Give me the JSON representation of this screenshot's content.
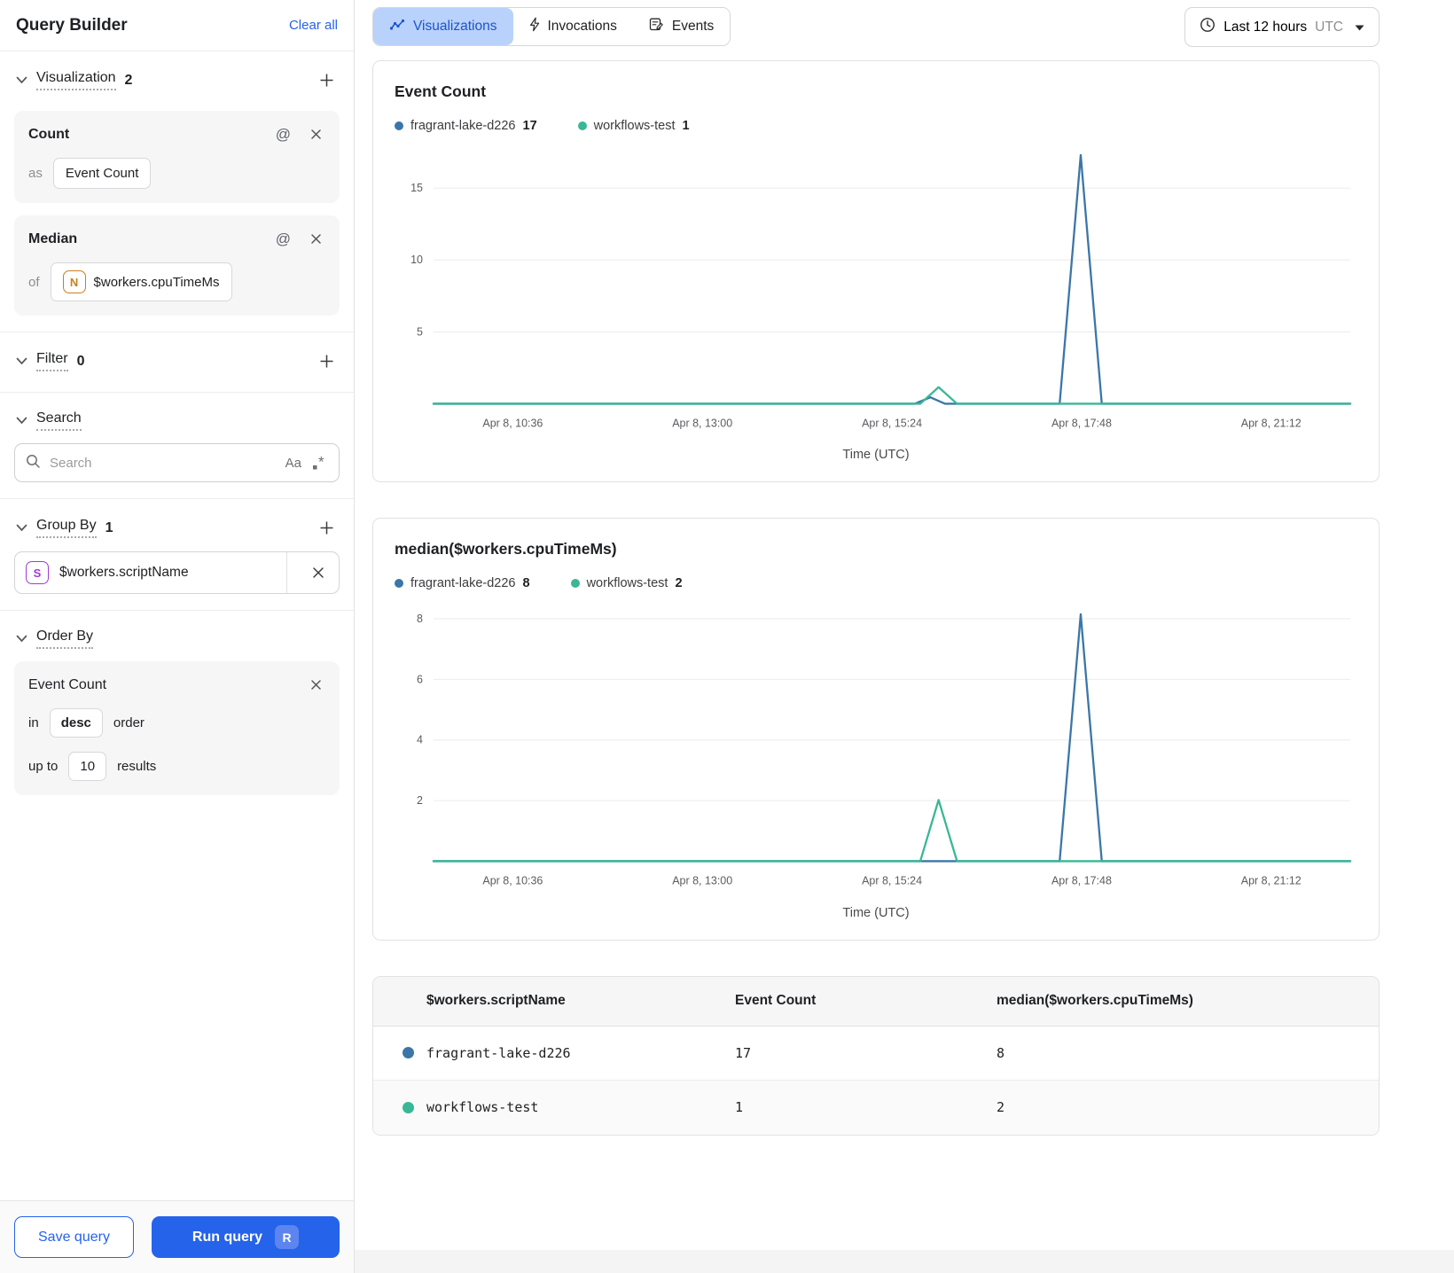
{
  "colors": {
    "series_blue": "#3b76a8",
    "series_green": "#3ab795",
    "accent_blue": "#2563eb",
    "tab_selected_bg": "#b9d2fb"
  },
  "sidebar": {
    "title": "Query Builder",
    "clear_all": "Clear all",
    "visualization": {
      "label": "Visualization",
      "count": "2",
      "cards": [
        {
          "title": "Count",
          "prefix": "as",
          "value": "Event Count"
        },
        {
          "title": "Median",
          "prefix": "of",
          "field_icon_letter": "N",
          "value": "$workers.cpuTimeMs"
        }
      ]
    },
    "filter": {
      "label": "Filter",
      "count": "0"
    },
    "search": {
      "label": "Search",
      "placeholder": "Search",
      "match_case": "Aa"
    },
    "group_by": {
      "label": "Group By",
      "count": "1",
      "item": {
        "icon_letter": "S",
        "value": "$workers.scriptName"
      }
    },
    "order_by": {
      "label": "Order By",
      "card": {
        "title": "Event Count",
        "in_label": "in",
        "direction": "desc",
        "order_label": "order",
        "up_to_label": "up to",
        "limit": "10",
        "results_label": "results"
      }
    },
    "footer": {
      "save": "Save query",
      "run": "Run query",
      "shortcut": "R"
    }
  },
  "header": {
    "tabs": [
      {
        "label": "Visualizations"
      },
      {
        "label": "Invocations"
      },
      {
        "label": "Events"
      }
    ],
    "time_range": {
      "label": "Last 12 hours",
      "timezone": "UTC"
    }
  },
  "chart_data": [
    {
      "type": "line",
      "title": "Event Count",
      "xlabel": "Time (UTC)",
      "x_ticks": [
        "Apr 8, 10:36",
        "Apr 8, 13:00",
        "Apr 8, 15:24",
        "Apr 8, 17:48",
        "Apr 8, 21:12"
      ],
      "y_ticks": [
        5,
        10,
        15
      ],
      "ylim": [
        0,
        17.6
      ],
      "legend_position": "top",
      "grid": true,
      "series": [
        {
          "name": "fragrant-lake-d226",
          "total": "17",
          "color": "#3b76a8",
          "points": [
            [
              0,
              0
            ],
            [
              0.525,
              0
            ],
            [
              0.542,
              0.45
            ],
            [
              0.558,
              0
            ],
            [
              0.683,
              0
            ],
            [
              0.706,
              17.3
            ],
            [
              0.729,
              0
            ],
            [
              1,
              0
            ]
          ]
        },
        {
          "name": "workflows-test",
          "total": "1",
          "color": "#3ab795",
          "points": [
            [
              0,
              0
            ],
            [
              0.531,
              0
            ],
            [
              0.551,
              1.15
            ],
            [
              0.571,
              0
            ],
            [
              1,
              0
            ]
          ]
        }
      ]
    },
    {
      "type": "line",
      "title": "median($workers.cpuTimeMs)",
      "xlabel": "Time (UTC)",
      "x_ticks": [
        "Apr 8, 10:36",
        "Apr 8, 13:00",
        "Apr 8, 15:24",
        "Apr 8, 17:48",
        "Apr 8, 21:12"
      ],
      "y_ticks": [
        2,
        4,
        6,
        8
      ],
      "ylim": [
        0,
        8.35
      ],
      "legend_position": "top",
      "grid": true,
      "series": [
        {
          "name": "fragrant-lake-d226",
          "total": "8",
          "color": "#3b76a8",
          "points": [
            [
              0,
              0
            ],
            [
              0.683,
              0
            ],
            [
              0.706,
              8.15
            ],
            [
              0.729,
              0
            ],
            [
              1,
              0
            ]
          ]
        },
        {
          "name": "workflows-test",
          "total": "2",
          "color": "#3ab795",
          "points": [
            [
              0,
              0
            ],
            [
              0.531,
              0
            ],
            [
              0.551,
              2.02
            ],
            [
              0.571,
              0
            ],
            [
              1,
              0
            ]
          ]
        }
      ]
    }
  ],
  "table": {
    "columns": [
      "$workers.scriptName",
      "Event Count",
      "median($workers.cpuTimeMs)"
    ],
    "rows": [
      {
        "name": "fragrant-lake-d226",
        "color": "#3b76a8",
        "event_count": "17",
        "median": "8"
      },
      {
        "name": "workflows-test",
        "color": "#3ab795",
        "event_count": "1",
        "median": "2"
      }
    ]
  }
}
